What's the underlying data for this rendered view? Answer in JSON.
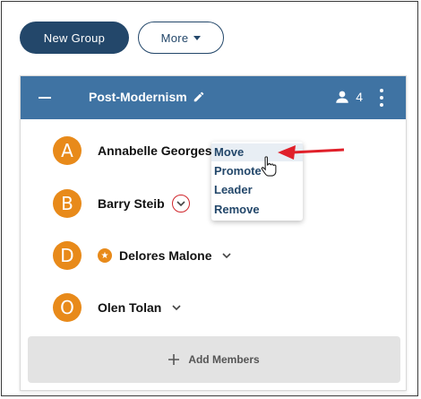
{
  "toolbar": {
    "new_group_label": "New Group",
    "more_label": "More"
  },
  "group": {
    "title": "Post-Modernism",
    "member_count": "4",
    "header_color": "#3f73a3"
  },
  "members": [
    {
      "initial": "A",
      "name": "Annabelle Georges"
    },
    {
      "initial": "B",
      "name": "Barry Steib"
    },
    {
      "initial": "D",
      "name": "Delores Malone",
      "leader": true
    },
    {
      "initial": "O",
      "name": "Olen Tolan"
    }
  ],
  "menu": {
    "items": [
      "Move",
      "Promote to",
      "Leader",
      "Remove"
    ]
  },
  "add_members_label": "Add Members",
  "colors": {
    "primary": "#23476a",
    "avatar": "#e88a1a",
    "annotation": "#e0202a"
  },
  "icons": [
    "collapse-icon",
    "pencil-icon",
    "person-icon",
    "kebab-icon",
    "chevron-down-icon",
    "star-icon",
    "plus-icon",
    "hand-cursor-icon"
  ]
}
